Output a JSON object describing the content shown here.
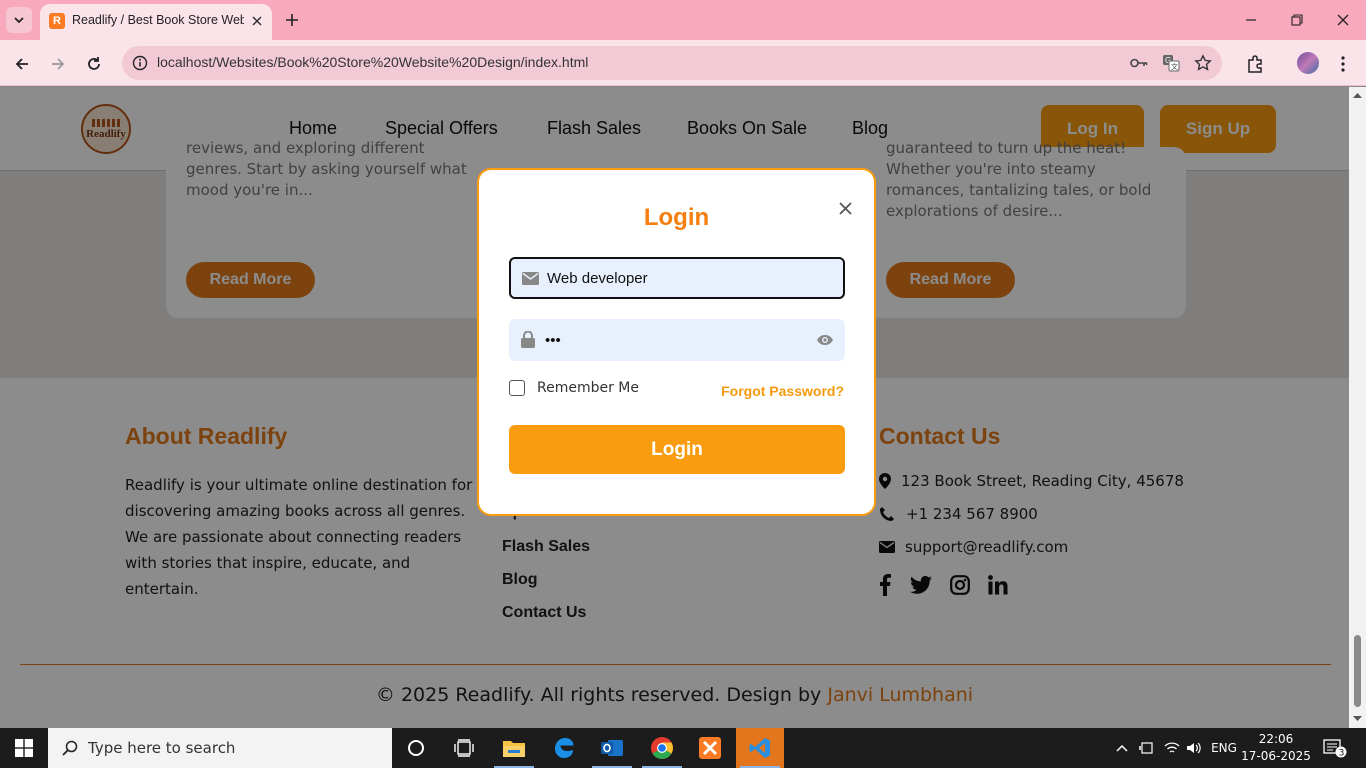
{
  "browser": {
    "tab_title": "Readlify / Best Book Store Website",
    "tab_favicon_glyph": "R",
    "url": "localhost/Websites/Book%20Store%20Website%20Design/index.html"
  },
  "site": {
    "logo_text": "Readlify",
    "nav": [
      "Home",
      "Special Offers",
      "Flash Sales",
      "Books On Sale",
      "Blog"
    ],
    "login_label": "Log In",
    "signup_label": "Sign Up",
    "accent_color": "#fa9c0f",
    "brand_color": "#e37a1b"
  },
  "cards": [
    {
      "text": "reviews, and exploring different genres. Start by asking yourself what mood you're in...",
      "button": "Read More"
    },
    {
      "text": "guaranteed to turn up the heat! Whether you're into steamy romances, tantalizing tales, or bold explorations of desire...",
      "button": "Read More"
    }
  ],
  "footer": {
    "about_heading": "About Readlify",
    "about_text": "Readlify is your ultimate online destination for discovering amazing books across all genres. We are passionate about connecting readers with stories that inspire, educate, and entertain.",
    "links": [
      "Special Offers",
      "Flash Sales",
      "Blog",
      "Contact Us"
    ],
    "contact_heading": "Contact Us",
    "address": "123 Book Street, Reading City, 45678",
    "phone": "+1 234 567 8900",
    "email": "support@readlify.com",
    "social": [
      "facebook-icon",
      "twitter-icon",
      "instagram-icon",
      "linkedin-icon"
    ],
    "copyright": "© 2025 Readlify. All rights reserved. Design by",
    "author": "Janvi Lumbhani"
  },
  "modal": {
    "title": "Login",
    "email_value": "Web developer",
    "password_value": "•••",
    "remember_label": "Remember Me",
    "forgot_label": "Forgot Password?",
    "submit_label": "Login"
  },
  "taskbar": {
    "search_placeholder": "Type here to search",
    "lang": "ENG",
    "time": "22:06",
    "date": "17-06-2025",
    "notifications": "3"
  }
}
